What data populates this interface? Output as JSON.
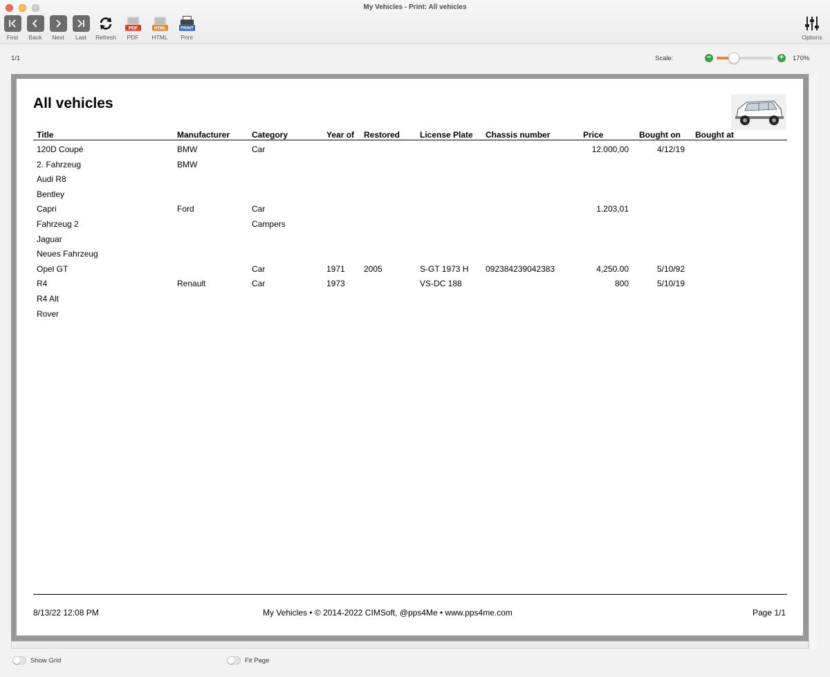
{
  "window": {
    "title": "My Vehicles - Print: All vehicles"
  },
  "toolbar": {
    "first": "First",
    "back": "Back",
    "next": "Next",
    "last": "Last",
    "refresh": "Refresh",
    "pdf": "PDF",
    "html": "HTML",
    "print": "Print",
    "options": "Options",
    "pdf_badge": "PDF",
    "html_badge": "HTML",
    "print_badge": "PRINT"
  },
  "status": {
    "page_count": "1/1",
    "scale_label": "Scale:",
    "zoom_value": "170%",
    "zoom_fraction": 0.3
  },
  "report": {
    "title": "All vehicles",
    "columns": [
      "Title",
      "Manufacturer",
      "Category",
      "Year of",
      "Restored",
      "License Plate",
      "Chassis number",
      "Price",
      "Bought on",
      "Bought at"
    ],
    "rows": [
      [
        "120D Coupé",
        "BMW",
        "Car",
        "",
        "",
        "",
        "",
        "12.000,00",
        "4/12/19",
        ""
      ],
      [
        "2. Fahrzeug",
        "BMW",
        "",
        "",
        "",
        "",
        "",
        "",
        "",
        ""
      ],
      [
        "Audi R8",
        "",
        "",
        "",
        "",
        "",
        "",
        "",
        "",
        ""
      ],
      [
        "Bentley",
        "",
        "",
        "",
        "",
        "",
        "",
        "",
        "",
        ""
      ],
      [
        "Capri",
        "Ford",
        "Car",
        "",
        "",
        "",
        "",
        "1.203,01",
        "",
        ""
      ],
      [
        "Fahrzeug 2",
        "",
        "Campers",
        "",
        "",
        "",
        "",
        "",
        "",
        ""
      ],
      [
        "Jaguar",
        "",
        "",
        "",
        "",
        "",
        "",
        "",
        "",
        ""
      ],
      [
        "Neues Fahrzeug",
        "",
        "",
        "",
        "",
        "",
        "",
        "",
        "",
        ""
      ],
      [
        "Opel GT",
        "",
        "Car",
        "1971",
        "2005",
        "S-GT 1973 H",
        "092384239042383",
        "4,250.00",
        "5/10/92",
        ""
      ],
      [
        "R4",
        "Renault",
        "Car",
        "1973",
        "",
        "VS-DC 188",
        "",
        "800",
        "5/10/19",
        ""
      ],
      [
        "R4 Alt",
        "",
        "",
        "",
        "",
        "",
        "",
        "",
        "",
        ""
      ],
      [
        "Rover",
        "",
        "",
        "",
        "",
        "",
        "",
        "",
        "",
        ""
      ]
    ],
    "footer": {
      "left": "8/13/22 12:08 PM",
      "center": "My Vehicles  •  © 2014-2022 CIMSoft, @pps4Me  •  www.pps4me.com",
      "right": "Page 1/1"
    }
  },
  "bottom": {
    "show_grid": "Show Grid",
    "fit_page": "Fit Page"
  },
  "colors": {
    "accent_orange": "#e2843a",
    "zoom_green": "#3aa04a",
    "pdf_red": "#d9412f",
    "html_orange": "#e08a2c",
    "print_blue": "#2f5fb8"
  }
}
